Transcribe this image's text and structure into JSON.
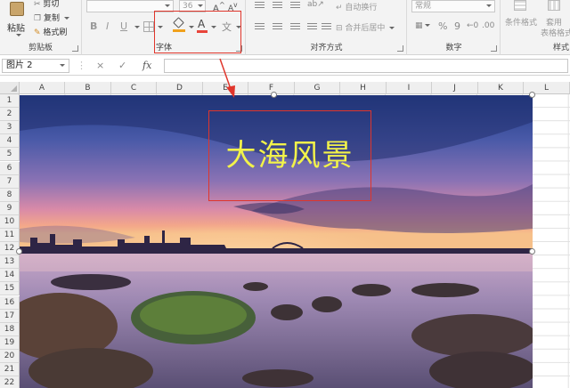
{
  "ribbon": {
    "clipboard": {
      "paste": "粘贴",
      "cut": "剪切",
      "copy": "复制",
      "format_painter": "格式刷",
      "label": "剪贴板"
    },
    "font": {
      "size": "36",
      "label": "字体",
      "bold": "B",
      "italic": "I",
      "underline": "U",
      "grow": "A",
      "shrink": "A",
      "font_color_glyph": "A"
    },
    "alignment": {
      "wrap_text": "自动换行",
      "merge_center": "合并后居中",
      "label": "对齐方式"
    },
    "number": {
      "format": "常规",
      "percent": "%",
      "comma": "9",
      "label": "数字"
    },
    "styles": {
      "conditional": "条件格式",
      "table_format_1": "套用",
      "table_format_2": "表格格式",
      "label": "样式"
    }
  },
  "formula_bar": {
    "name_box": "图片 2",
    "cancel": "×",
    "enter": "✓",
    "fx": "fx",
    "content": ""
  },
  "columns": [
    "A",
    "B",
    "C",
    "D",
    "E",
    "F",
    "G",
    "H",
    "I",
    "J",
    "K",
    "L"
  ],
  "rows": [
    "1",
    "2",
    "3",
    "4",
    "5",
    "6",
    "7",
    "8",
    "9",
    "10",
    "11",
    "12",
    "13",
    "14",
    "15",
    "16",
    "17",
    "18",
    "19",
    "20",
    "21",
    "22"
  ],
  "picture": {
    "title": "大海风景"
  },
  "colors": {
    "annotation_red": "#e0352b",
    "title_yellow": "#f2f24a",
    "font_color_bar": "#e8443a"
  }
}
